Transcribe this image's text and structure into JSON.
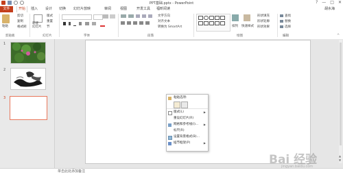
{
  "window": {
    "title": "PPT基础.pptx - PowerPoint",
    "user": "胡水海",
    "controls": [
      "?",
      "—",
      "□",
      "✕"
    ]
  },
  "tabs": [
    {
      "label": "文件",
      "active": false
    },
    {
      "label": "开始",
      "active": true
    },
    {
      "label": "插入",
      "active": false
    },
    {
      "label": "设计",
      "active": false
    },
    {
      "label": "切换",
      "active": false
    },
    {
      "label": "幻灯片放映",
      "active": false
    },
    {
      "label": "审阅",
      "active": false
    },
    {
      "label": "视图",
      "active": false
    },
    {
      "label": "开发工具",
      "active": false
    },
    {
      "label": "福昕阅读",
      "active": false
    }
  ],
  "ribbon": {
    "clipboard": {
      "paste": "粘贴",
      "cut": "剪切",
      "copy": "复制",
      "format_painter": "格式刷",
      "label": "剪贴板"
    },
    "slides": {
      "new": "新建\n幻灯片",
      "layout": "版式",
      "reset": "重置",
      "section": "节",
      "label": "幻灯片"
    },
    "font": {
      "label": "字体"
    },
    "paragraph": {
      "text_direction": "文字方向",
      "align_text": "对齐文本",
      "smartart": "转换为 SmartArt",
      "label": "段落"
    },
    "drawing": {
      "arrange": "排列",
      "quick_styles": "快速样式",
      "fill": "形状填充",
      "outline": "形状轮廓",
      "effects": "形状效果",
      "label": "绘图"
    },
    "editing": {
      "find": "查找",
      "replace": "替换",
      "select": "选择",
      "label": "编辑"
    }
  },
  "thumbnails": [
    {
      "number": "1",
      "selected": false
    },
    {
      "number": "2",
      "selected": false
    },
    {
      "number": "3",
      "selected": true
    }
  ],
  "notes_placeholder": "单击此处添加备注",
  "context_menu": {
    "title": "粘贴选项:",
    "items": [
      {
        "label": "版式(L)",
        "submenu": true,
        "icon": "layout-icon"
      },
      {
        "label": "重设幻灯片(R)",
        "submenu": false,
        "icon": ""
      },
      {
        "label": "网格和参考线(I)...",
        "submenu": true,
        "icon": "grid-icon"
      },
      {
        "label": "标尺(R)",
        "submenu": false,
        "icon": ""
      },
      {
        "label": "设置背景格式(B)...",
        "submenu": false,
        "icon": "background-icon"
      },
      {
        "label": "插节框架(P)",
        "submenu": true,
        "icon": "comment-icon"
      }
    ]
  },
  "watermark": {
    "text": "Bai 经验",
    "sub": "jingyan.baidu.com"
  },
  "colors": {
    "accent": "#c43e1c",
    "selected_border": "#e8765a"
  }
}
